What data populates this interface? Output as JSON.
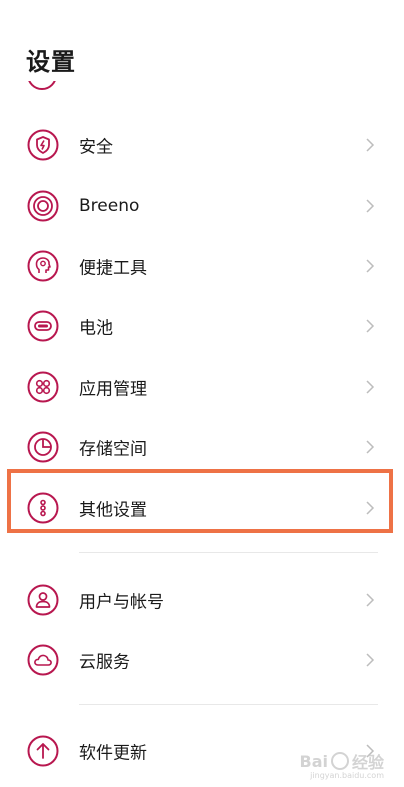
{
  "header": {
    "title": "设置"
  },
  "accent_color": "#b8174f",
  "highlight_color": "#ee7246",
  "menu": {
    "items": [
      {
        "label": "安全",
        "icon": "shield-lightning-icon"
      },
      {
        "label": "Breeno",
        "icon": "breeno-ring-icon"
      },
      {
        "label": "便捷工具",
        "icon": "head-bulb-icon"
      },
      {
        "label": "电池",
        "icon": "battery-icon"
      },
      {
        "label": "应用管理",
        "icon": "app-grid-icon"
      },
      {
        "label": "存储空间",
        "icon": "pie-chart-icon"
      },
      {
        "label": "其他设置",
        "icon": "more-dots-icon"
      },
      {
        "label": "用户与帐号",
        "icon": "user-icon"
      },
      {
        "label": "云服务",
        "icon": "cloud-icon"
      },
      {
        "label": "软件更新",
        "icon": "arrow-up-icon"
      }
    ]
  },
  "watermark": {
    "brand": "Bai",
    "suffix": "经验",
    "site": "jingyan.baidu.com"
  }
}
